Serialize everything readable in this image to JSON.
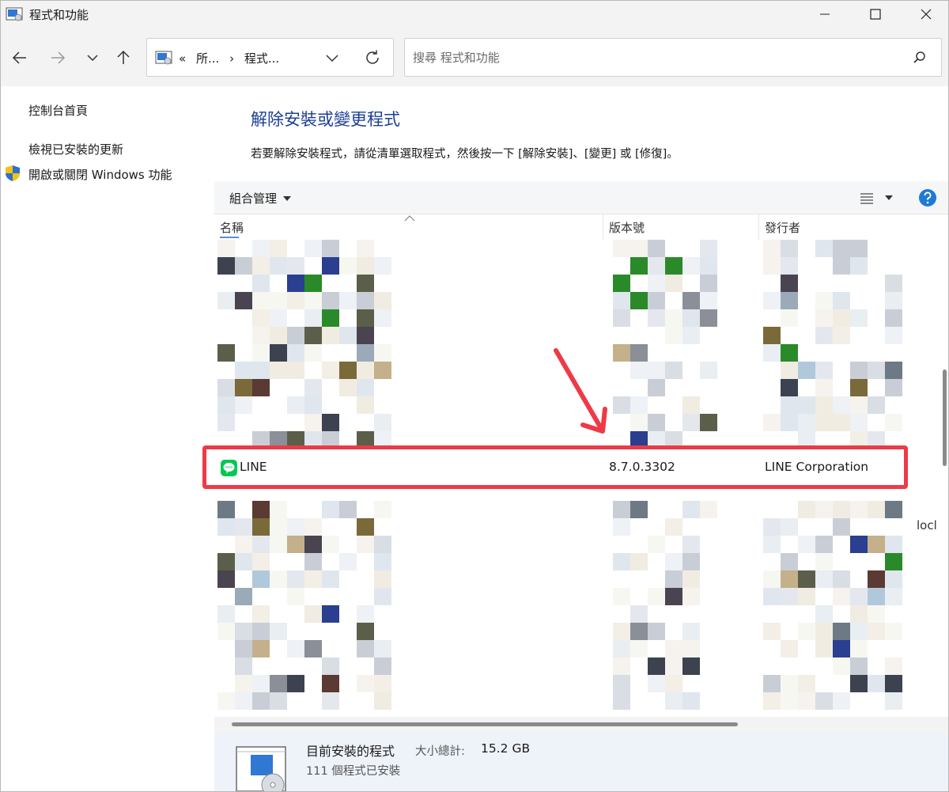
{
  "window": {
    "title": "程式和功能"
  },
  "nav": {
    "crumb_overflow": "«",
    "crumb_1": "所...",
    "crumb_sep": "›",
    "crumb_2": "程式...",
    "search_placeholder": "搜尋 程式和功能"
  },
  "sidebar": {
    "items": [
      {
        "label": "控制台首頁"
      },
      {
        "label": "檢視已安裝的更新"
      },
      {
        "label": "開啟或關閉 Windows 功能"
      }
    ]
  },
  "main": {
    "heading": "解除安裝或變更程式",
    "description": "若要解除安裝程式，請從清單選取程式，然後按一下 [解除安裝]、[變更] 或 [修復]。"
  },
  "toolbar": {
    "organize_label": "組合管理"
  },
  "columns": {
    "name": "名稱",
    "version": "版本號",
    "publisher": "發行者"
  },
  "highlighted_program": {
    "name": "LINE",
    "version": "8.7.0.3302",
    "publisher": "LINE Corporation"
  },
  "partial_text": "locl",
  "status": {
    "title": "目前安裝的程式",
    "size_label": "大小總計:",
    "size_value": "15.2 GB",
    "count_text": "111 個程式已安裝"
  },
  "colors": {
    "heading_blue": "#1c3f94",
    "highlight_red": "#ee3a47",
    "line_green": "#06c755",
    "status_bg": "#eef3fa"
  }
}
